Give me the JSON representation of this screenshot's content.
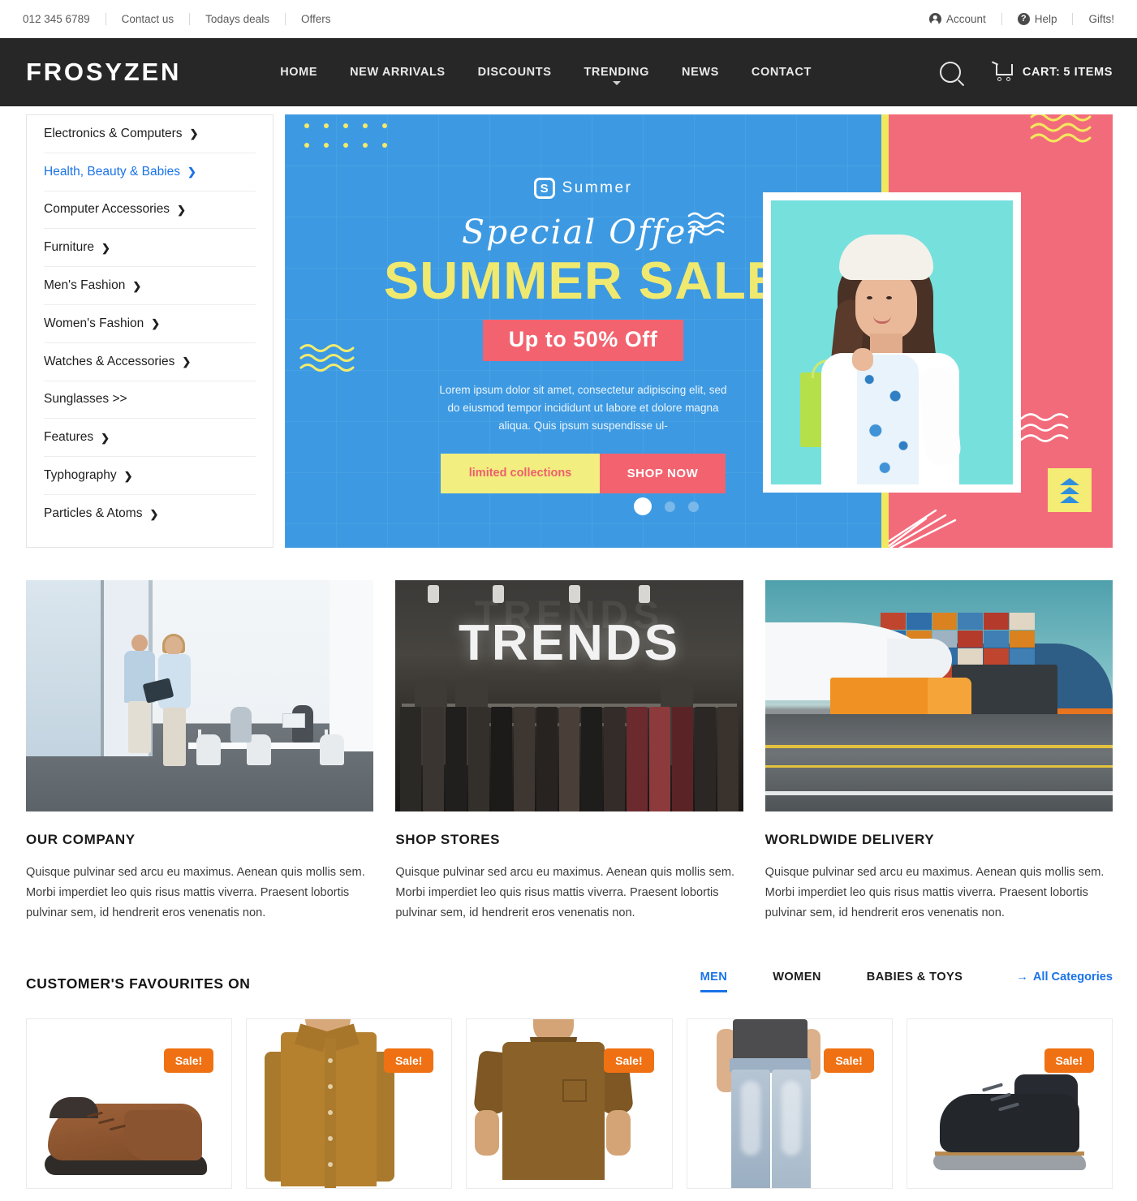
{
  "topbar": {
    "phone": "012 345 6789",
    "links": [
      "Contact us",
      "Todays deals",
      "Offers"
    ],
    "account": "Account",
    "help": "Help",
    "gifts": "Gifts!"
  },
  "navbar": {
    "brand": "FROSYZEN",
    "links": [
      "HOME",
      "NEW ARRIVALS",
      "DISCOUNTS",
      "TRENDING",
      "NEWS",
      "CONTACT"
    ],
    "dropdown_on": "TRENDING",
    "cart_label": "CART:",
    "cart_count": "5 ITEMS"
  },
  "categories": {
    "items": [
      {
        "label": "Electronics & Computers",
        "arrow": "❯",
        "active": false
      },
      {
        "label": "Health, Beauty & Babies",
        "arrow": "❯",
        "active": true
      },
      {
        "label": "Computer Accessories",
        "arrow": "❯",
        "active": false
      },
      {
        "label": "Furniture",
        "arrow": "❯",
        "active": false
      },
      {
        "label": "Men's Fashion",
        "arrow": "❯",
        "active": false
      },
      {
        "label": "Women's Fashion",
        "arrow": "❯",
        "active": false
      },
      {
        "label": "Watches & Accessories",
        "arrow": "❯",
        "active": false
      },
      {
        "label": "Sunglasses >>",
        "arrow": "",
        "active": false
      },
      {
        "label": "Features",
        "arrow": "❯",
        "active": false
      },
      {
        "label": "Typhography",
        "arrow": "❯",
        "active": false
      },
      {
        "label": "Particles & Atoms",
        "arrow": "❯",
        "active": false
      }
    ]
  },
  "banner": {
    "logo_mark": "S",
    "logo_word": "Summer",
    "eyebrow": "Special Offer",
    "headline": "SUMMER SALE",
    "discount": "Up to 50% Off",
    "description": "Lorem ipsum dolor sit amet, consectetur adipiscing elit, sed do eiusmod tempor incididunt ut labore et dolore magna aliqua. Quis ipsum suspendisse ul-",
    "btn_secondary": "limited collections",
    "btn_primary": "SHOP NOW",
    "slide_count": 3,
    "active_slide": 1,
    "colors": {
      "blue": "#3d9ae2",
      "pink": "#f26b7a",
      "yellow": "#f2e85f",
      "teal": "#76e0dd"
    }
  },
  "features": [
    {
      "title": "OUR COMPANY",
      "text": "Quisque pulvinar sed arcu eu maximus. Aenean quis mollis sem. Morbi imperdiet leo quis risus mattis viverra. Praesent lobortis pulvinar sem, id hendrerit eros venenatis non.",
      "image": "office-meeting-photo"
    },
    {
      "title": "SHOP STORES",
      "text": "Quisque pulvinar sed arcu eu maximus. Aenean quis mollis sem. Morbi imperdiet leo quis risus mattis viverra. Praesent lobortis pulvinar sem, id hendrerit eros venenatis non.",
      "image": "trends-store-photo",
      "sign_text": "TRENDS"
    },
    {
      "title": "WORLDWIDE DELIVERY",
      "text": "Quisque pulvinar sed arcu eu maximus. Aenean quis mollis sem. Morbi imperdiet leo quis risus mattis viverra. Praesent lobortis pulvinar sem, id hendrerit eros venenatis non.",
      "image": "logistics-photo"
    }
  ],
  "favourites": {
    "title": "CUSTOMER'S FAVOURITES ON",
    "tabs": [
      {
        "label": "MEN",
        "active": true
      },
      {
        "label": "WOMEN",
        "active": false
      },
      {
        "label": "BABIES & TOYS",
        "active": false
      }
    ],
    "all_categories": "All Categories",
    "all_arrow": "→",
    "products": [
      {
        "badge": "Sale!",
        "art": "brown-dress-shoe"
      },
      {
        "badge": "Sale!",
        "art": "tan-button-shirt"
      },
      {
        "badge": "Sale!",
        "art": "brown-tshirt"
      },
      {
        "badge": "Sale!",
        "art": "light-wash-jeans"
      },
      {
        "badge": "Sale!",
        "art": "black-chukka-boot"
      }
    ]
  },
  "accent_colors": {
    "link_blue": "#1a73e8",
    "sale_orange": "#ef7113",
    "nav_dark": "#272727"
  }
}
